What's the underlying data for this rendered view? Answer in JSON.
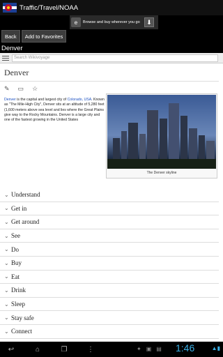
{
  "app": {
    "title": "Traffic/Travel/NOAA"
  },
  "ad": {
    "text": "Browse and buy wherever you go",
    "logo_text": "ebay"
  },
  "toolbar": {
    "back_label": "Back",
    "favorites_label": "Add to Favorites"
  },
  "page_header": "Denver",
  "search": {
    "placeholder": "Search Wikivoyage"
  },
  "article": {
    "title": "Denver",
    "intro_parts": {
      "p1": "Denver",
      "p2": " is the capital and largest city of ",
      "link": "Colorado, USA",
      "p3": ". Known as \"The Mile-High City\", Denver sits at an altitude of 5,280 feet (1,600 meters above sea level and lies where the Great Plains give way to the Rocky Mountains. Denver is a large city and one of the fastest growing in the United States"
    },
    "figure_caption": "The Denver skyline",
    "sections": [
      "Understand",
      "Get in",
      "Get around",
      "See",
      "Do",
      "Buy",
      "Eat",
      "Drink",
      "Sleep",
      "Stay safe",
      "Connect"
    ]
  },
  "system": {
    "time": "1:46",
    "status": "▲▮"
  },
  "colors": {
    "link": "#1a4fc1",
    "clock": "#3ab0e6"
  }
}
